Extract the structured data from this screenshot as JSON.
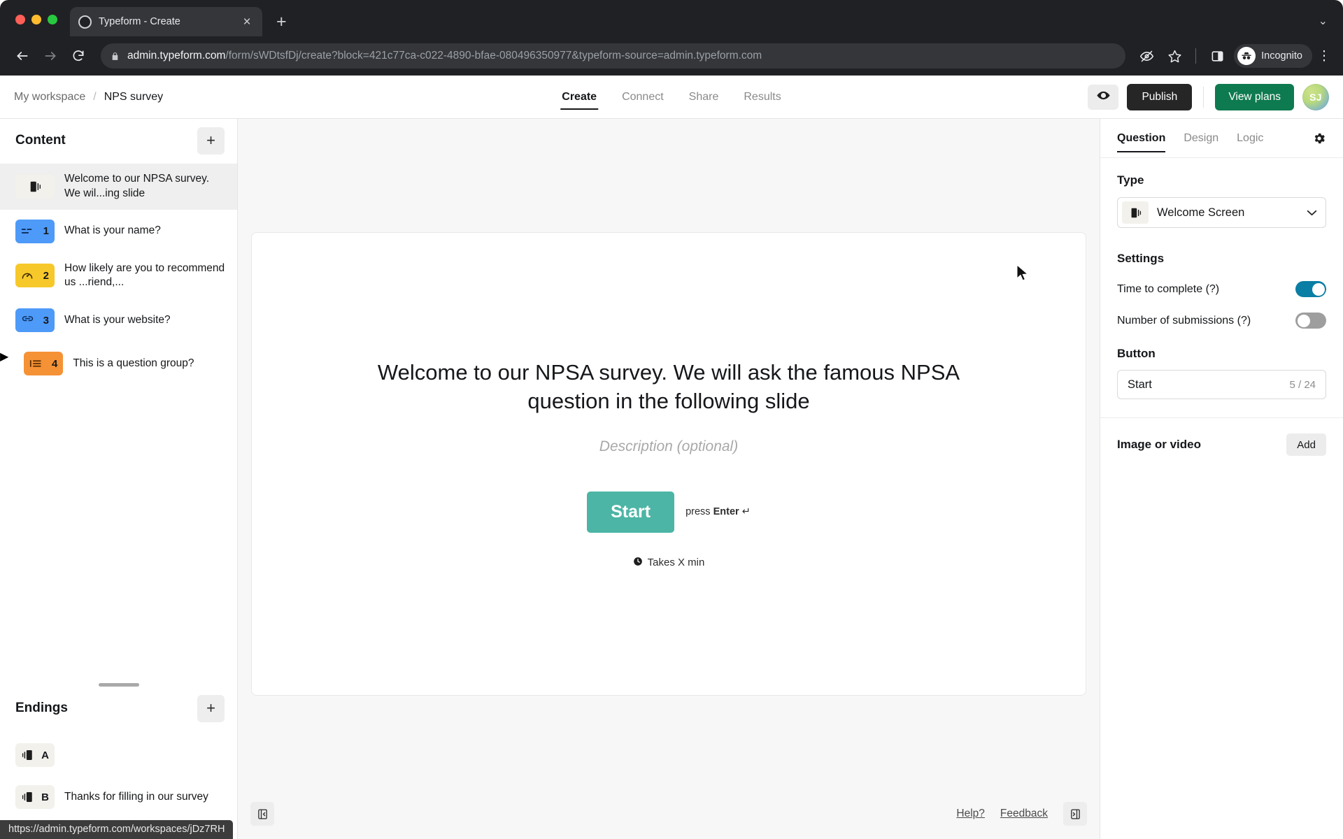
{
  "browser": {
    "tab_title": "Typeform - Create",
    "tab_close": "×",
    "new_tab": "+",
    "url_domain": "admin.typeform.com",
    "url_path": "/form/sWDtsfDj/create?block=421c77ca-c022-4890-bfae-080496350977&typeform-source=admin.typeform.com",
    "profile_label": "Incognito",
    "kebab": "⋮",
    "tablist_chevron": "⌄"
  },
  "app_header": {
    "workspace": "My workspace",
    "separator": "/",
    "form_name": "NPS survey",
    "tabs": [
      {
        "label": "Create",
        "active": true
      },
      {
        "label": "Connect",
        "active": false
      },
      {
        "label": "Share",
        "active": false
      },
      {
        "label": "Results",
        "active": false
      }
    ],
    "publish_label": "Publish",
    "view_plans_label": "View plans",
    "avatar_initials": "SJ"
  },
  "sidebar": {
    "title": "Content",
    "add_label": "+",
    "items": [
      {
        "label": "Welcome to our NPSA survey. We wil...ing slide",
        "badge": "",
        "kind": "welcome",
        "selected": true,
        "expandable": false
      },
      {
        "label": "What is your name?",
        "badge": "1",
        "kind": "blue",
        "selected": false,
        "expandable": false
      },
      {
        "label": "How likely are you to recommend us ...riend,...",
        "badge": "2",
        "kind": "yellow",
        "selected": false,
        "expandable": false
      },
      {
        "label": "What is your website?",
        "badge": "3",
        "kind": "blue",
        "selected": false,
        "expandable": false
      },
      {
        "label": "This is a question group?",
        "badge": "4",
        "kind": "orange",
        "selected": false,
        "expandable": true
      }
    ],
    "endings": {
      "title": "Endings",
      "add_label": "+",
      "items": [
        {
          "label": "",
          "badge": "A"
        },
        {
          "label": "Thanks for filling in our survey",
          "badge": "B"
        }
      ]
    }
  },
  "canvas": {
    "title": "Welcome to our NPSA survey. We will ask the famous NPSA question in the following slide",
    "description_placeholder": "Description (optional)",
    "start_button": "Start",
    "press_enter_prefix": "press ",
    "press_enter_key": "Enter",
    "press_enter_symbol": "↵",
    "takes_label": "Takes X min"
  },
  "bottom_bar": {
    "help_label": "Help?",
    "feedback_label": "Feedback"
  },
  "right_panel": {
    "tabs": [
      {
        "label": "Question",
        "active": true
      },
      {
        "label": "Design",
        "active": false
      },
      {
        "label": "Logic",
        "active": false
      }
    ],
    "type_label": "Type",
    "type_value": "Welcome Screen",
    "type_chevron": "⌄",
    "settings_label": "Settings",
    "settings": [
      {
        "label": "Time to complete (?)",
        "on": true
      },
      {
        "label": "Number of submissions (?)",
        "on": false
      }
    ],
    "button_label": "Button",
    "button_value": "Start",
    "button_counter": "5 / 24",
    "image_or_video_label": "Image or video",
    "add_label": "Add"
  },
  "status_bar": {
    "url": "https://admin.typeform.com/workspaces/jDz7RH"
  },
  "colors": {
    "accent_green": "#0e7a4f",
    "publish_dark": "#262627",
    "toggle_on": "#0a7ea4",
    "start_teal": "#4cb5a5",
    "badge_blue": "#4e9af8",
    "badge_yellow": "#f7c82a",
    "badge_orange": "#f59236"
  }
}
